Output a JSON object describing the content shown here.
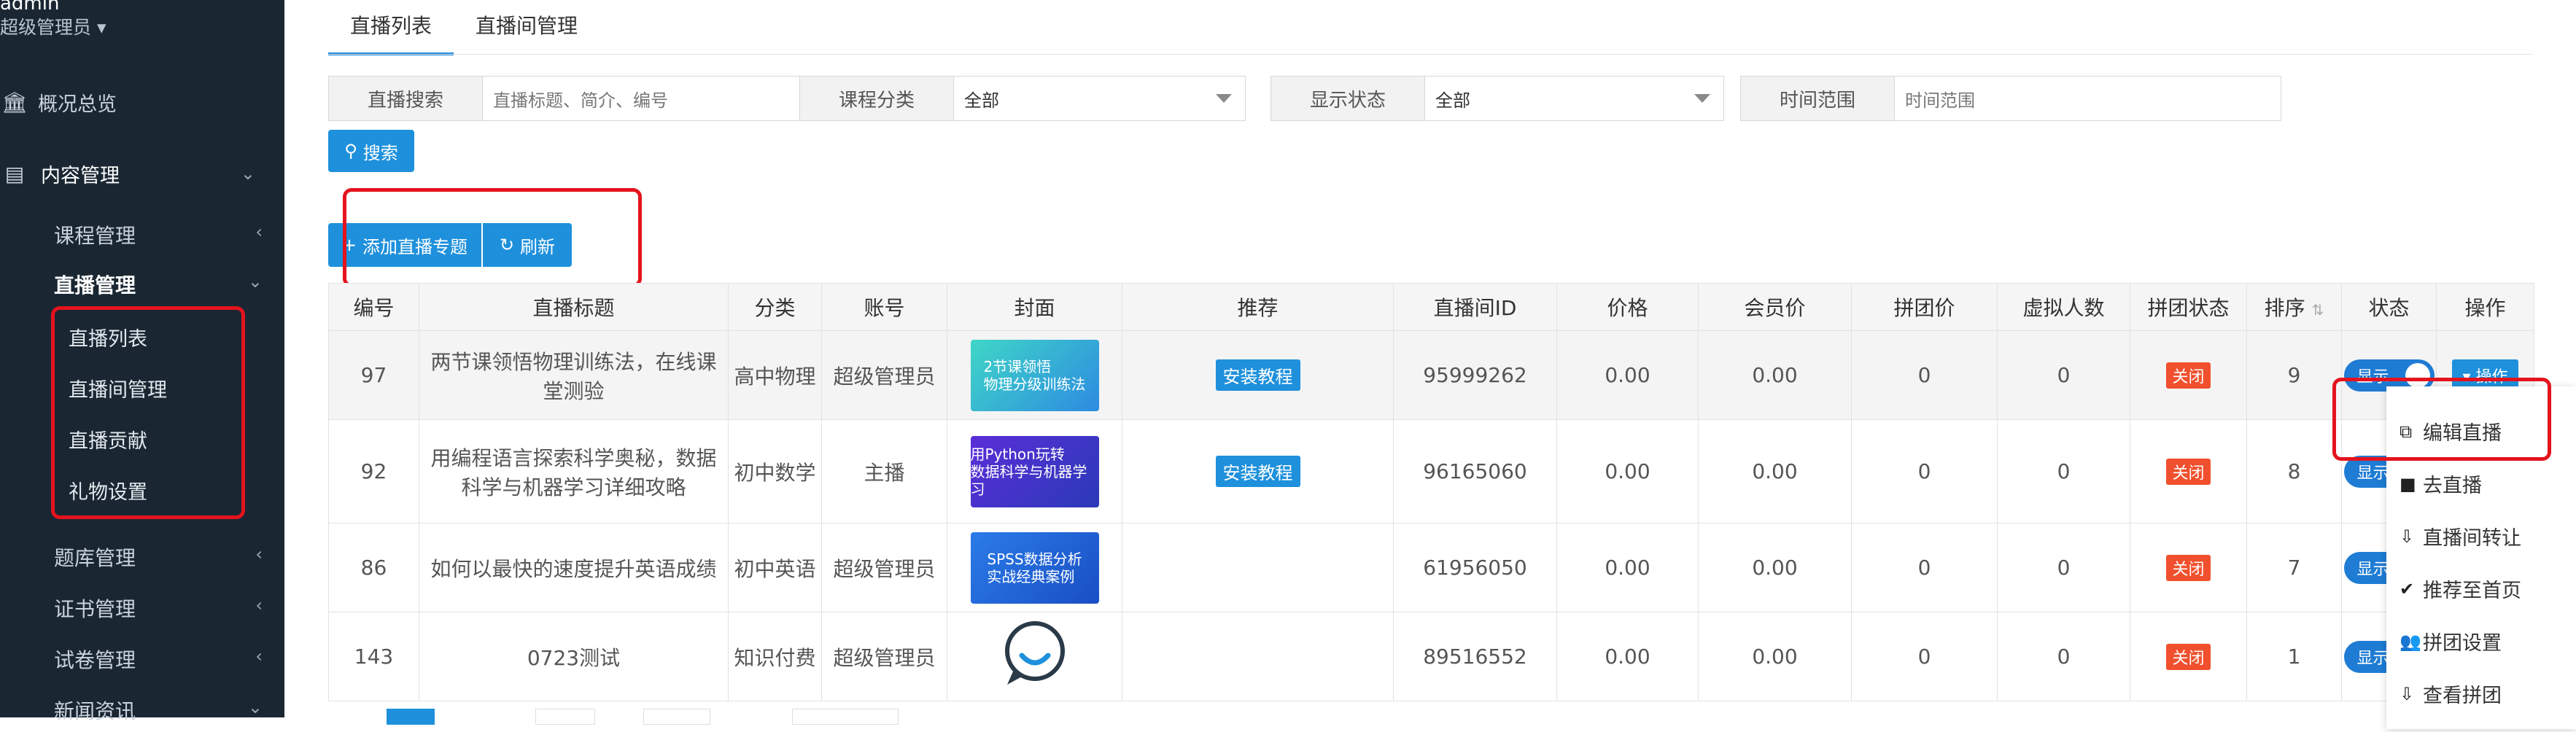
{
  "sidebar": {
    "username": "admin",
    "role": "超级管理员",
    "overview": "概况总览",
    "content_mgmt": "内容管理",
    "course_mgmt": "课程管理",
    "live_mgmt": "直播管理",
    "live_children": [
      "直播列表",
      "直播间管理",
      "直播贡献",
      "礼物设置"
    ],
    "question_bank": "题库管理",
    "certificate": "证书管理",
    "exam": "试卷管理",
    "news": "新闻资讯"
  },
  "tabs": [
    "直播列表",
    "直播间管理"
  ],
  "filters": {
    "search_label": "直播搜索",
    "search_placeholder": "直播标题、简介、编号",
    "category_label": "课程分类",
    "category_value": "全部",
    "status_label": "显示状态",
    "status_value": "全部",
    "time_label": "时间范围",
    "time_placeholder": "时间范围"
  },
  "buttons": {
    "search": "搜索",
    "add_topic": "添加直播专题",
    "refresh": "刷新"
  },
  "table": {
    "headers": [
      "编号",
      "直播标题",
      "分类",
      "账号",
      "封面",
      "推荐",
      "直播间ID",
      "价格",
      "会员价",
      "拼团价",
      "虚拟人数",
      "拼团状态",
      "排序",
      "状态",
      "操作"
    ],
    "rows": [
      {
        "id": "97",
        "title": "两节课领悟物理训练法，在线课堂测验",
        "category": "高中物理",
        "account": "超级管理员",
        "cover_text": "2节课领悟\n物理分级训练法",
        "recommend": "安装教程",
        "room_id": "95999262",
        "price": "0.00",
        "vip_price": "0.00",
        "group_price": "0",
        "virtual": "0",
        "group_status": "关闭",
        "sort": "9",
        "status": "显示",
        "op": "操作"
      },
      {
        "id": "92",
        "title": "用编程语言探索科学奥秘，数据科学与机器学习详细攻略",
        "category": "初中数学",
        "account": "主播",
        "cover_text": "用Python玩转\n数据科学与机器学习",
        "recommend": "安装教程",
        "room_id": "96165060",
        "price": "0.00",
        "vip_price": "0.00",
        "group_price": "0",
        "virtual": "0",
        "group_status": "关闭",
        "sort": "8",
        "status": "显示",
        "op": ""
      },
      {
        "id": "86",
        "title": "如何以最快的速度提升英语成绩",
        "category": "初中英语",
        "account": "超级管理员",
        "cover_text": "SPSS数据分析\n实战经典案例",
        "recommend": "",
        "room_id": "61956050",
        "price": "0.00",
        "vip_price": "0.00",
        "group_price": "0",
        "virtual": "0",
        "group_status": "关闭",
        "sort": "7",
        "status": "显示",
        "op": ""
      },
      {
        "id": "143",
        "title": "0723测试",
        "category": "知识付费",
        "account": "超级管理员",
        "cover_text": "",
        "recommend": "",
        "room_id": "89516552",
        "price": "0.00",
        "vip_price": "0.00",
        "group_price": "0",
        "virtual": "0",
        "group_status": "关闭",
        "sort": "1",
        "status": "显示",
        "op": ""
      }
    ]
  },
  "op_menu": [
    "编辑直播",
    "去直播",
    "直播间转让",
    "推荐至首页",
    "拼团设置",
    "查看拼团"
  ],
  "colors": {
    "primary": "#1e90dc",
    "sidebar_bg": "#1a2733",
    "highlight": "#e5131d",
    "badge": "#f0502d"
  }
}
